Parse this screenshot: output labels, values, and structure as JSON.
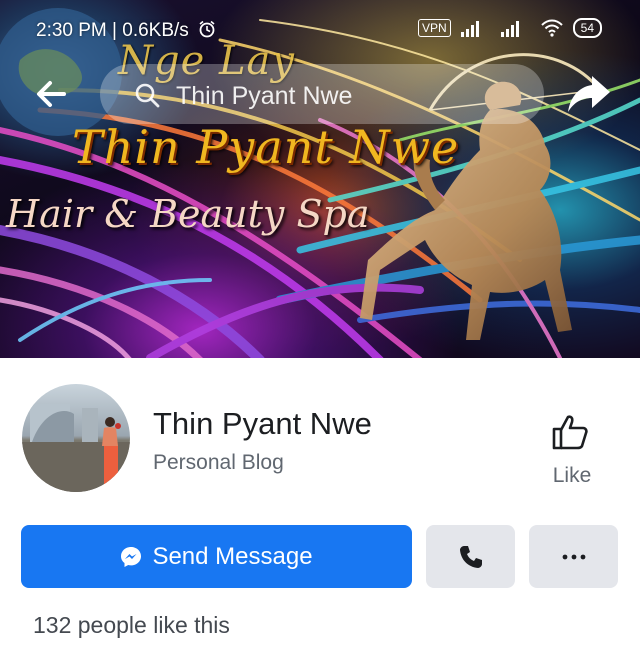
{
  "status_bar": {
    "time_and_speed": "2:30 PM | 0.6KB/s",
    "vpn": "VPN",
    "battery": "54"
  },
  "header": {
    "search_text": "Thin Pyant Nwe"
  },
  "cover": {
    "line1": "Nge Lay",
    "line2": "Thin Pyant Nwe",
    "line3": "Hair & Beauty Spa"
  },
  "profile": {
    "name": "Thin Pyant Nwe",
    "category": "Personal Blog"
  },
  "actions": {
    "like_label": "Like",
    "send_message_label": "Send Message"
  },
  "likes_count": "132 people like this",
  "colors": {
    "accent": "#1877f2",
    "secondary_button": "#e4e6eb",
    "title_gold": "#f0b720"
  },
  "icons": [
    "back-arrow-icon",
    "search-icon",
    "share-icon",
    "like-thumb-icon",
    "messenger-icon",
    "phone-icon",
    "more-dots-icon",
    "alarm-icon",
    "signal-icon",
    "wifi-icon"
  ]
}
